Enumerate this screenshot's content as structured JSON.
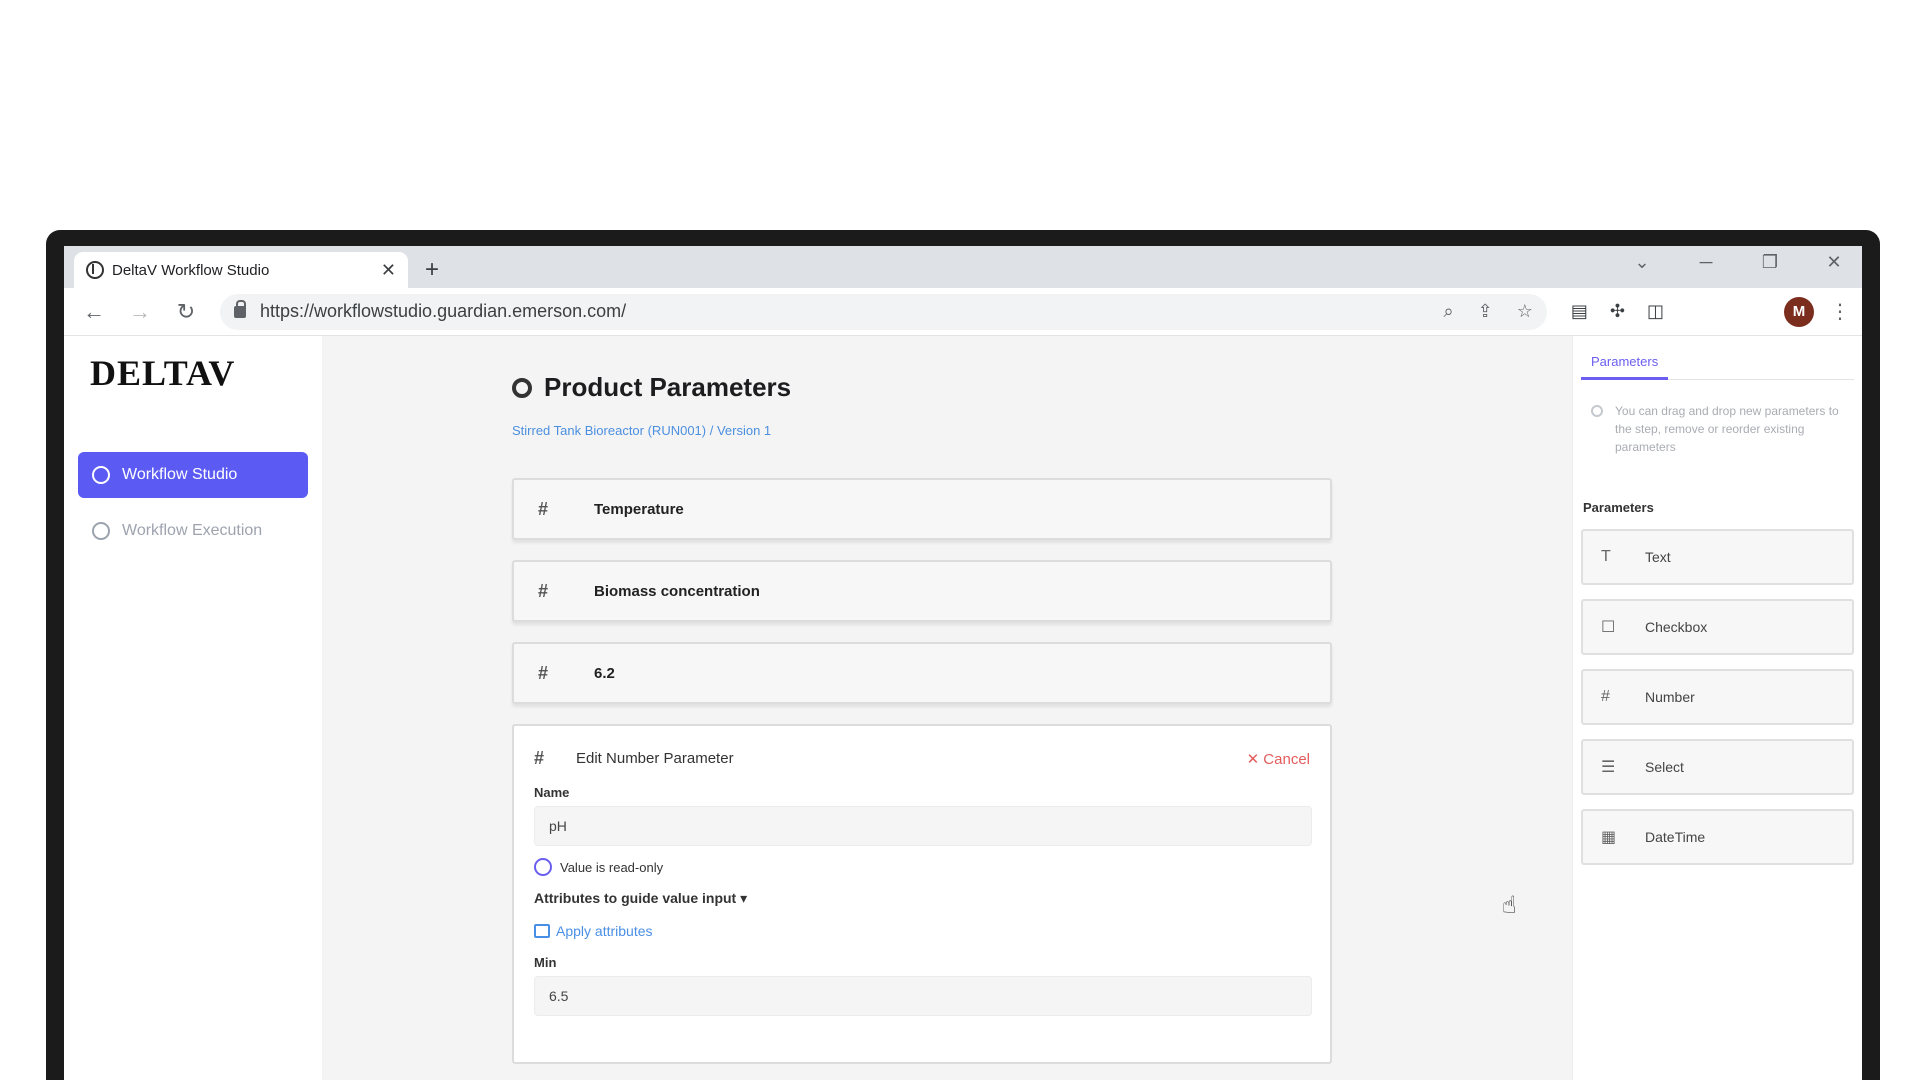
{
  "browser": {
    "tab_title": "DeltaV Workflow Studio",
    "tab_close": "✕",
    "new_tab": "+",
    "window_controls": [
      "⌄",
      "─",
      "❐",
      "✕"
    ],
    "url": "https://workflowstudio.guardian.emerson.com/",
    "back": "←",
    "forward": "→",
    "reload": "↻",
    "avatar_initial": "M"
  },
  "sidebar": {
    "logo": "DELTAV",
    "items": [
      {
        "label": "Workflow Studio",
        "active": true
      },
      {
        "label": "Workflow Execution",
        "active": false
      }
    ]
  },
  "main": {
    "title": "Product Parameters",
    "breadcrumb": "Stirred Tank Bioreactor (RUN001) / Version 1",
    "params": [
      {
        "icon": "#",
        "name": "Temperature"
      },
      {
        "icon": "#",
        "name": "Biomass concentration"
      },
      {
        "icon": "#",
        "name": "6.2"
      }
    ],
    "edit": {
      "icon": "#",
      "title": "Edit Number Parameter",
      "cancel": "✕ Cancel",
      "name_label": "Name",
      "name_value": "pH",
      "readonly_label": "Value is read-only",
      "attrs_label": "Attributes to guide value input ▾",
      "apply_label": "Apply attributes",
      "min_label": "Min",
      "min_value": "6.5"
    }
  },
  "right_panel": {
    "tab": "Parameters",
    "hint": "You can drag and drop new parameters to the step, remove or reorder existing parameters",
    "section": "Parameters",
    "items": [
      {
        "icon": "T",
        "label": "Text"
      },
      {
        "icon": "☐",
        "label": "Checkbox"
      },
      {
        "icon": "#",
        "label": "Number"
      },
      {
        "icon": "☰",
        "label": "Select"
      },
      {
        "icon": "▦",
        "label": "DateTime"
      }
    ]
  }
}
